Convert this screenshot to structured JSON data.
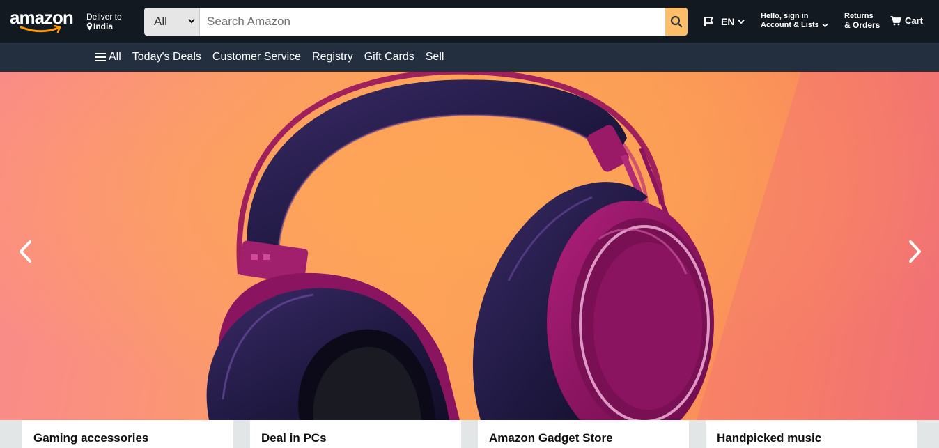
{
  "header": {
    "logo_text": "amazon",
    "deliver": {
      "line1": "Deliver to",
      "line2": "India"
    },
    "search": {
      "category": "All",
      "placeholder": "Search Amazon"
    },
    "language": "EN",
    "account": {
      "line1": "Hello, sign in",
      "line2": "Account & Lists"
    },
    "returns": {
      "line1": "Returns",
      "line2": "& Orders"
    },
    "cart": "Cart"
  },
  "subnav": {
    "all_label": "All",
    "items": [
      {
        "label": "Today's Deals"
      },
      {
        "label": "Customer Service"
      },
      {
        "label": "Registry"
      },
      {
        "label": "Gift Cards"
      },
      {
        "label": "Sell"
      }
    ]
  },
  "hero": {
    "image_subject": "headphones"
  },
  "cards": [
    {
      "title": "Gaming accessories"
    },
    {
      "title": "Deal in PCs"
    },
    {
      "title": "Amazon Gadget Store"
    },
    {
      "title": "Handpicked music"
    }
  ],
  "colors": {
    "nav_bg": "#131921",
    "subnav_bg": "#232f3e",
    "search_button": "#febd69",
    "smile": "#ff9900"
  }
}
